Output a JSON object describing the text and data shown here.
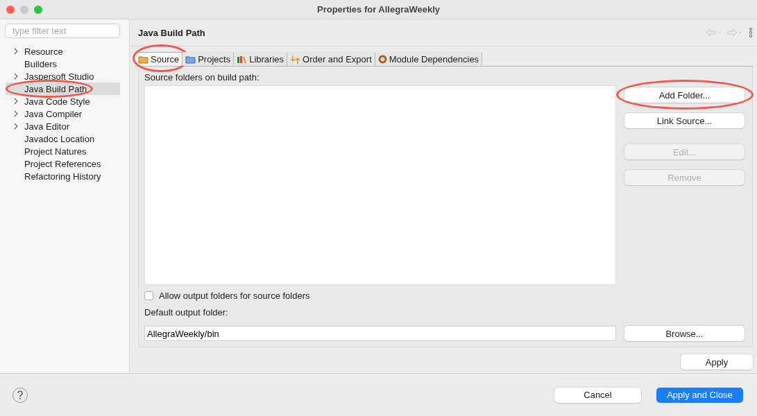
{
  "window": {
    "title": "Properties for AllegraWeekly"
  },
  "sidebar": {
    "filter": {
      "placeholder": "type filter text"
    },
    "items": [
      {
        "label": "Resource",
        "expandable": true,
        "selected": false,
        "circled": false
      },
      {
        "label": "Builders",
        "expandable": false,
        "selected": false,
        "circled": false
      },
      {
        "label": "Jaspersoft Studio",
        "expandable": true,
        "selected": false,
        "circled": false
      },
      {
        "label": "Java Build Path",
        "expandable": false,
        "selected": true,
        "circled": true
      },
      {
        "label": "Java Code Style",
        "expandable": true,
        "selected": false,
        "circled": false
      },
      {
        "label": "Java Compiler",
        "expandable": true,
        "selected": false,
        "circled": false
      },
      {
        "label": "Java Editor",
        "expandable": true,
        "selected": false,
        "circled": false
      },
      {
        "label": "Javadoc Location",
        "expandable": false,
        "selected": false,
        "circled": false
      },
      {
        "label": "Project Natures",
        "expandable": false,
        "selected": false,
        "circled": false
      },
      {
        "label": "Project References",
        "expandable": false,
        "selected": false,
        "circled": false
      },
      {
        "label": "Refactoring History",
        "expandable": false,
        "selected": false,
        "circled": false
      }
    ]
  },
  "page": {
    "title": "Java Build Path",
    "tabs": [
      {
        "label": "Source",
        "kind": "source",
        "selected": true,
        "circled": true
      },
      {
        "label": "Projects",
        "kind": "projects",
        "selected": false,
        "circled": false
      },
      {
        "label": "Libraries",
        "kind": "libraries",
        "selected": false,
        "circled": false
      },
      {
        "label": "Order and Export",
        "kind": "order",
        "selected": false,
        "circled": false
      },
      {
        "label": "Module Dependencies",
        "kind": "module",
        "selected": false,
        "circled": false
      }
    ],
    "list_label": "Source folders on build path:",
    "side_buttons": [
      {
        "label": "Add Folder...",
        "disabled": false,
        "circled": true
      },
      {
        "label": "Link Source...",
        "disabled": false,
        "circled": false
      },
      {
        "label": "Edit...",
        "disabled": true,
        "circled": false
      },
      {
        "label": "Remove",
        "disabled": true,
        "circled": false
      }
    ],
    "allow_output": {
      "label": "Allow output folders for source folders",
      "checked": false
    },
    "output_label": "Default output folder:",
    "output_value": "AllegraWeekly/bin",
    "browse": "Browse...",
    "apply": "Apply"
  },
  "footer": {
    "cancel": "Cancel",
    "apply_close": "Apply and Close"
  }
}
